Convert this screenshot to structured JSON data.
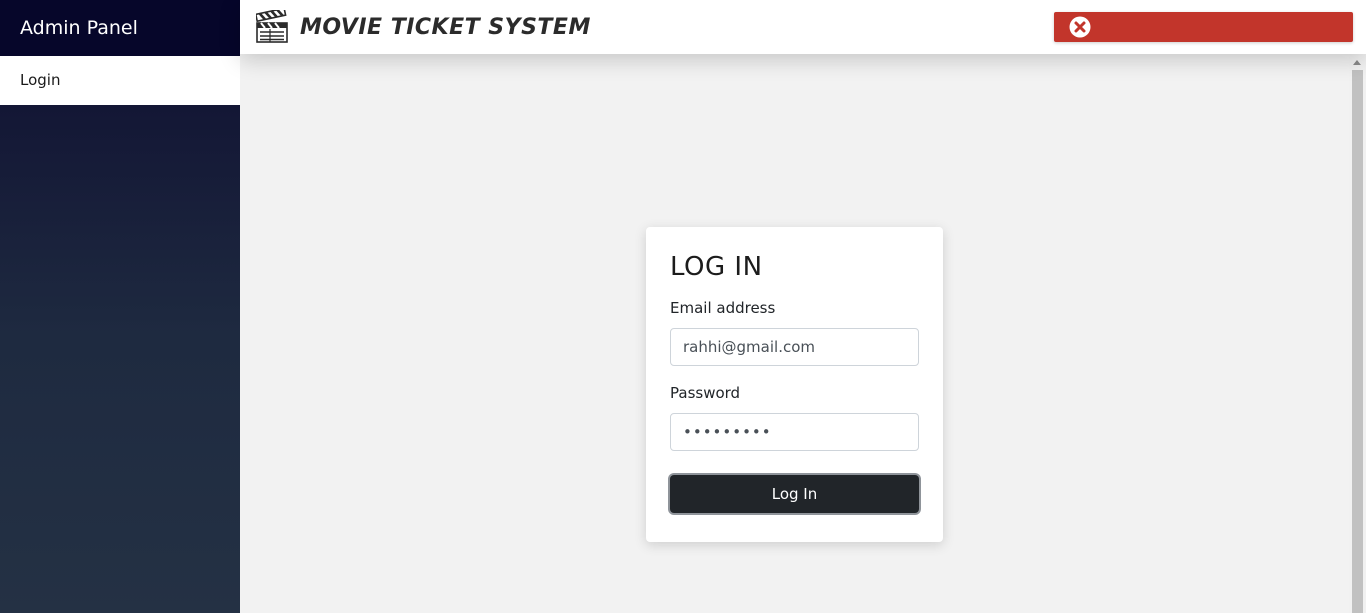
{
  "sidebar": {
    "title": "Admin Panel",
    "items": [
      {
        "label": "Login"
      }
    ]
  },
  "header": {
    "brand_text": "Movie Ticket System",
    "brand_icon": "clapperboard-icon"
  },
  "alert": {
    "icon": "close-circle-icon",
    "color": "#c2352b",
    "message": ""
  },
  "login": {
    "title": "LOG IN",
    "email_label": "Email address",
    "email_value": "rahhi@gmail.com",
    "password_label": "Password",
    "password_value": "•••••••••",
    "submit_label": "Log In"
  },
  "colors": {
    "sidebar_dark": "#06062a",
    "page_background": "#f2f2f2",
    "button_dark": "#212529",
    "alert_red": "#c2352b"
  }
}
